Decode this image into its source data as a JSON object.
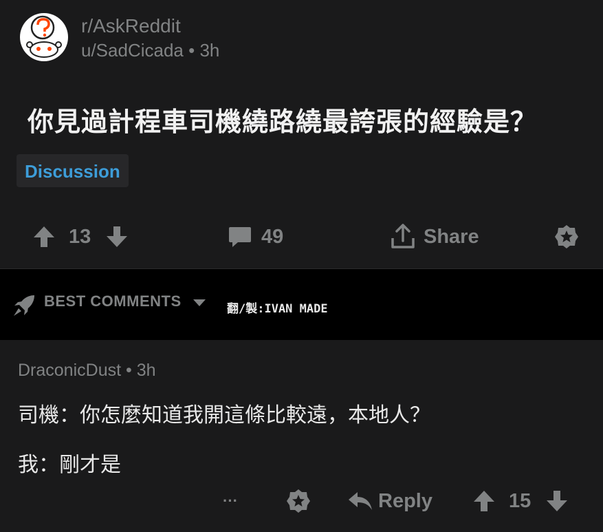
{
  "post": {
    "subreddit": "r/AskReddit",
    "author": "u/SadCicada",
    "separator": "•",
    "age": "3h",
    "title": "你見過計程車司機繞路繞最誇張的經驗是？",
    "flair": "Discussion",
    "upvotes": "13",
    "comments": "49",
    "share_label": "Share"
  },
  "sort": {
    "label": "BEST COMMENTS",
    "credit": "翻/製:IVAN MADE"
  },
  "comment": {
    "author": "DraconicDust",
    "separator": "•",
    "age": "3h",
    "line1": "司機：你怎麼知道我開這條比較遠，本地人？",
    "line2": "我：剛才是",
    "more": "···",
    "reply_label": "Reply",
    "score": "15"
  },
  "icons": {
    "avatar": "askreddit-snoo-icon",
    "upvote": "arrow-up-icon",
    "downvote": "arrow-down-icon",
    "comment": "comment-bubble-icon",
    "share": "share-icon",
    "award": "award-icon",
    "rocket": "rocket-icon",
    "dropdown": "caret-down-icon",
    "reply": "reply-arrow-icon",
    "more": "ellipsis-icon"
  },
  "colors": {
    "background": "#1a1a1b",
    "muted": "#818384",
    "flair_text": "#3d9dd9"
  }
}
